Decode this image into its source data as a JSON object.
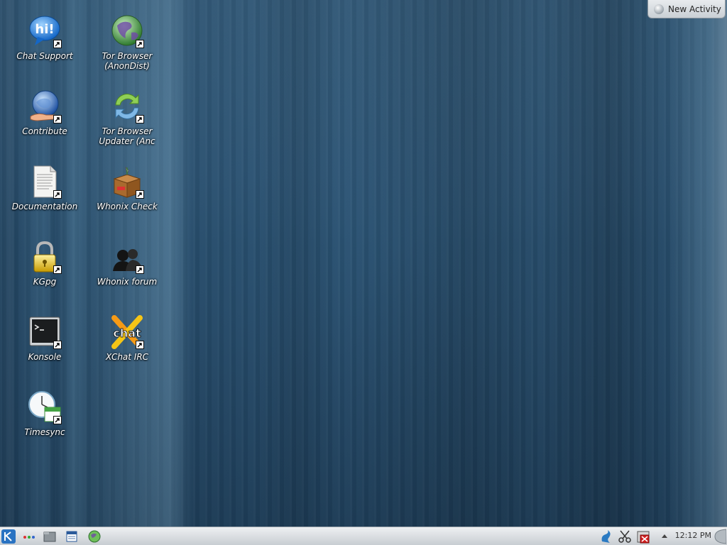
{
  "desktop": {
    "icons": [
      {
        "label": "Chat Support",
        "icon": "chat-bubble-icon"
      },
      {
        "label": "Tor Browser (AnonDist)",
        "icon": "globe-icon"
      },
      {
        "label": "Contribute",
        "icon": "globe-hand-icon"
      },
      {
        "label": "Tor Browser Updater (Anc",
        "icon": "refresh-icon"
      },
      {
        "label": "Documentation",
        "icon": "document-icon"
      },
      {
        "label": "Whonix Check",
        "icon": "box-icon"
      },
      {
        "label": "KGpg",
        "icon": "padlock-icon"
      },
      {
        "label": "Whonix forum",
        "icon": "users-icon"
      },
      {
        "label": "Konsole",
        "icon": "terminal-icon"
      },
      {
        "label": "XChat IRC",
        "icon": "xchat-icon"
      },
      {
        "label": "Timesync",
        "icon": "clock-icon"
      }
    ]
  },
  "activity": {
    "new_activity_label": "New Activity"
  },
  "panel": {
    "launcher_icon": "kde-launcher-icon",
    "tasks": [
      "activity-dots-icon",
      "file-manager-icon",
      "calendar-icon",
      "globe-icon"
    ],
    "tray": [
      "network-icon",
      "scissors-icon",
      "disabled-icon"
    ],
    "clock": "12:12 PM"
  },
  "colors": {
    "wallpaper": "#2b5475",
    "panel": "#dde1e5",
    "label_text": "#ffffff"
  }
}
